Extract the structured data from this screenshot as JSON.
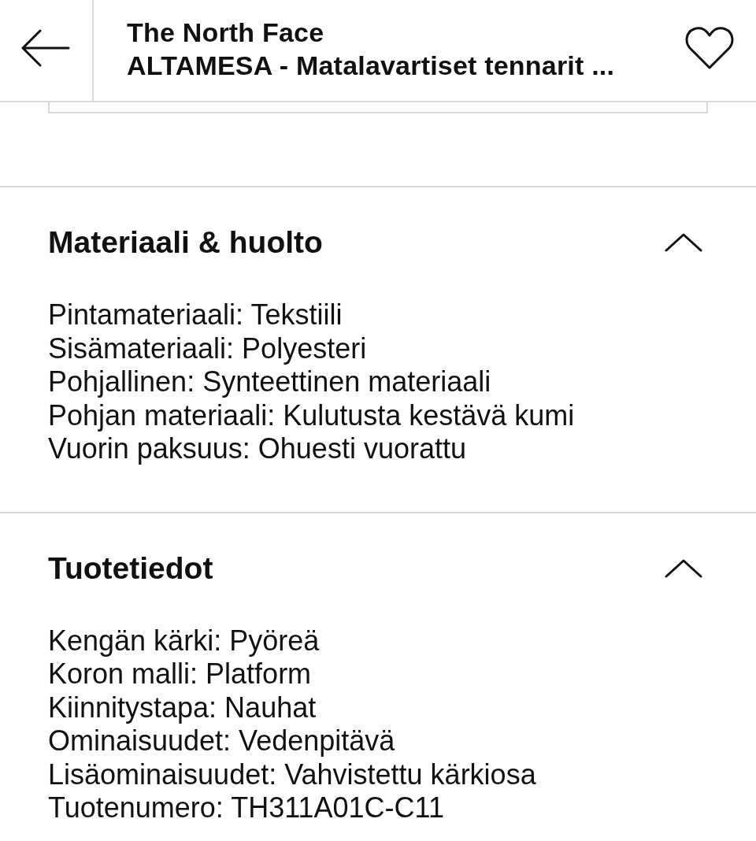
{
  "header": {
    "brand": "The North Face",
    "product_name": "ALTAMESA - Matalavartiset tennarit ...",
    "favorited": false
  },
  "sections": [
    {
      "title": "Materiaali & huolto",
      "expanded": true,
      "lines": [
        "Pintamateriaali: Tekstiili",
        "Sisämateriaali: Polyesteri",
        "Pohjallinen: Synteettinen materiaali",
        "Pohjan materiaali: Kulutusta kestävä kumi",
        "Vuorin paksuus: Ohuesti vuorattu"
      ]
    },
    {
      "title": "Tuotetiedot",
      "expanded": true,
      "lines": [
        "Kengän kärki: Pyöreä",
        "Koron malli: Platform",
        "Kiinnitystapa: Nauhat",
        "Ominaisuudet: Vedenpitävä",
        "Lisäominaisuudet: Vahvistettu kärkiosa",
        "Tuotenumero: TH311A01C-C11"
      ]
    }
  ]
}
